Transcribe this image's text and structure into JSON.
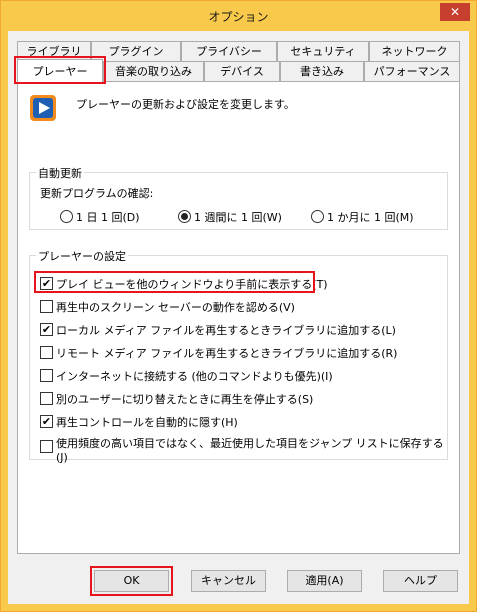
{
  "window": {
    "title": "オプション",
    "close_glyph": "✕"
  },
  "tabs_row1": [
    "ライブラリ",
    "プラグイン",
    "プライバシー",
    "セキュリティ",
    "ネットワーク"
  ],
  "tabs_row2": [
    "プレーヤー",
    "音楽の取り込み",
    "デバイス",
    "書き込み",
    "パフォーマンス"
  ],
  "active_tab": "プレーヤー",
  "header": {
    "description": "プレーヤーの更新および設定を変更します。"
  },
  "auto_update": {
    "group_title": "自動更新",
    "label": "更新プログラムの確認:",
    "options": [
      {
        "label": "1 日 1 回(D)",
        "selected": false
      },
      {
        "label": "1 週間に 1 回(W)",
        "selected": true
      },
      {
        "label": "1 か月に 1 回(M)",
        "selected": false
      }
    ]
  },
  "player_settings": {
    "group_title": "プレーヤーの設定",
    "items": [
      {
        "label": "プレイ ビューを他のウィンドウより手前に表示する(T)",
        "checked": true
      },
      {
        "label": "再生中のスクリーン セーバーの動作を認める(V)",
        "checked": false
      },
      {
        "label": "ローカル メディア ファイルを再生するときライブラリに追加する(L)",
        "checked": true
      },
      {
        "label": "リモート メディア ファイルを再生するときライブラリに追加する(R)",
        "checked": false
      },
      {
        "label": "インターネットに接続する (他のコマンドよりも優先)(I)",
        "checked": false
      },
      {
        "label": "別のユーザーに切り替えたときに再生を停止する(S)",
        "checked": false
      },
      {
        "label": "再生コントロールを自動的に隠す(H)",
        "checked": true
      },
      {
        "label": "使用頻度の高い項目ではなく、最近使用した項目をジャンプ リストに保存する",
        "label_line2": "(J)",
        "checked": false
      }
    ]
  },
  "buttons": {
    "ok": "OK",
    "cancel": "キャンセル",
    "apply": "適用(A)",
    "help": "ヘルプ"
  },
  "colors": {
    "highlight": "#e8141c",
    "title_bar": "#f8c94a",
    "close": "#c7402f"
  }
}
